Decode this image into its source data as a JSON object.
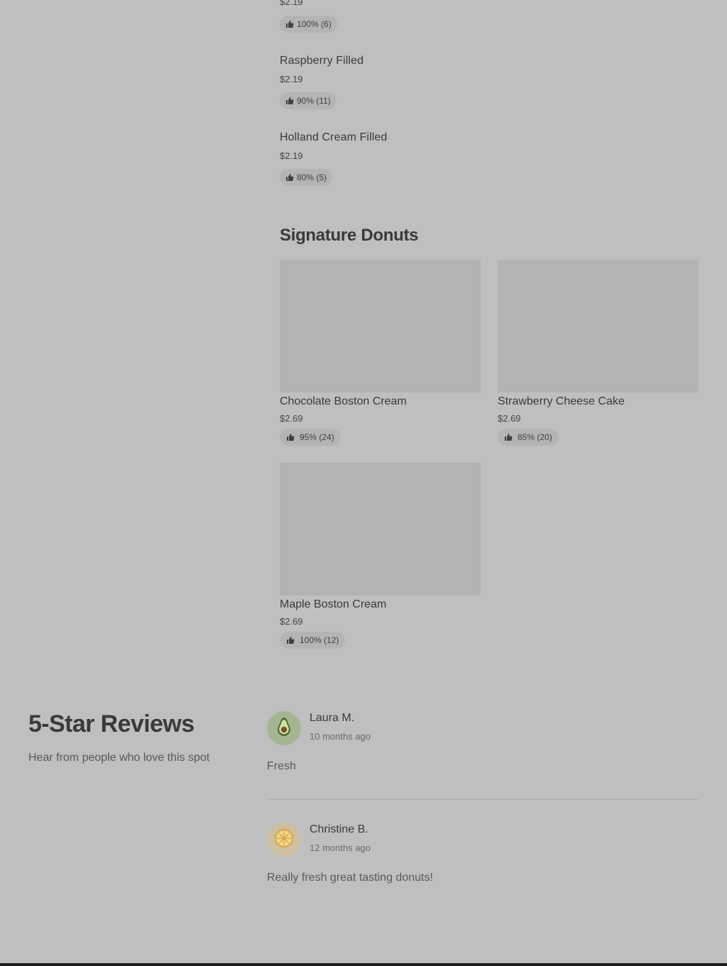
{
  "menu": {
    "items_top": [
      {
        "name": "",
        "price": "$2.19",
        "rating": "100% (6)"
      },
      {
        "name": "Raspberry Filled",
        "price": "$2.19",
        "rating": "90% (11)"
      },
      {
        "name": "Holland Cream Filled",
        "price": "$2.19",
        "rating": "80% (5)"
      }
    ],
    "signature": {
      "title": "Signature Donuts",
      "cards": [
        {
          "name": "Chocolate Boston Cream",
          "price": "$2.69",
          "rating": "95% (24)"
        },
        {
          "name": "Strawberry Cheese Cake",
          "price": "$2.69",
          "rating": "85% (20)"
        },
        {
          "name": "Maple Boston Cream",
          "price": "$2.69",
          "rating": "100% (12)"
        }
      ]
    }
  },
  "reviews": {
    "title": "5-Star Reviews",
    "subtitle": "Hear from people who love this spot",
    "list": [
      {
        "name": "Laura M.",
        "time": "10 months ago",
        "text": "Fresh",
        "avatar_icon": "avocado-icon",
        "avatar_color": "#a4b592"
      },
      {
        "name": "Christine B.",
        "time": "12 months ago",
        "text": "Really fresh great tasting donuts!",
        "avatar_icon": "lemon-slice-icon",
        "avatar_color": "#cdbf9f"
      }
    ]
  },
  "colors": {
    "background": "#bfbfbf",
    "placeholder_image": "#b3b3b3",
    "pill": "#b4b4b4",
    "bottom_bar": "#1c1c1c"
  }
}
